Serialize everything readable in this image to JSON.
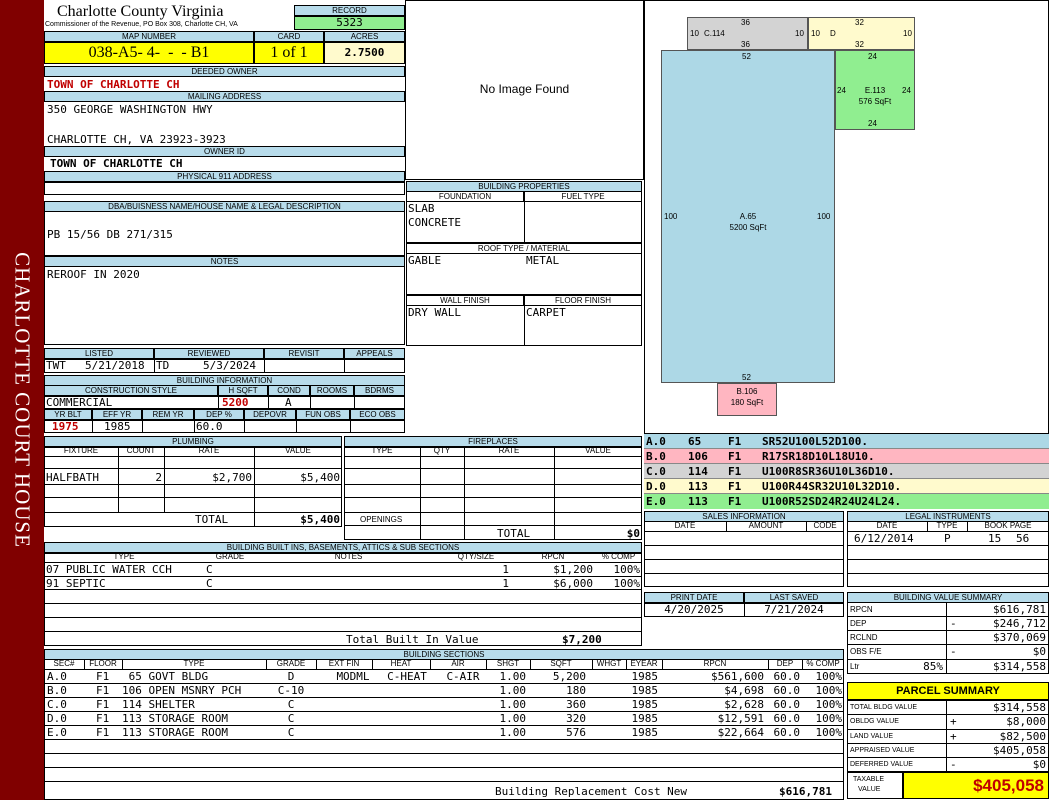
{
  "sidebar_title": "CHARLOTTE COURT HOUSE",
  "header": {
    "county": "Charlotte County Virginia",
    "commissioner": "Commissioner of the Revenue, PO Box 308, Charlotte CH, VA",
    "record_label": "RECORD",
    "record": "5323",
    "map_number_label": "MAP NUMBER",
    "map_number": "038-A5- 4-  -  - B1",
    "card_label": "CARD",
    "card": "1 of 1",
    "acres_label": "ACRES",
    "acres": "2.7500"
  },
  "owner": {
    "deeded_owner_label": "DEEDED OWNER",
    "deeded_owner": "TOWN OF CHARLOTTE CH",
    "mailing_address_label": "MAILING ADDRESS",
    "address_line1": "350 GEORGE WASHINGTON HWY",
    "address_line2": "CHARLOTTE CH, VA 23923-3923",
    "owner_id_label": "OWNER ID",
    "owner_id": "TOWN OF CHARLOTTE CH",
    "physical_address_label": "PHYSICAL 911 ADDRESS",
    "physical_address": "",
    "dba_label": "DBA/BUISNESS NAME/HOUSE NAME & LEGAL DESCRIPTION",
    "legal_description": "PB 15/56 DB 271/315",
    "notes_label": "NOTES",
    "notes": "REROOF IN 2020"
  },
  "listing": {
    "listed_label": "LISTED",
    "reviewed_label": "REVIEWED",
    "revisit_label": "REVISIT",
    "appeals_label": "APPEALS",
    "listed_by": "TWT",
    "listed_date": "5/21/2018",
    "reviewed_by": "TD",
    "reviewed_date": "5/3/2024"
  },
  "building_info": {
    "title": "BUILDING INFORMATION",
    "construction_style_label": "CONSTRUCTION STYLE",
    "hsqft_label": "H SQFT",
    "cond_label": "COND",
    "rooms_label": "ROOMS",
    "bdrms_label": "BDRMS",
    "construction_style": "COMMERCIAL",
    "hsqft": "5200",
    "cond": "A",
    "yr_blt_label": "YR BLT",
    "eff_yr_label": "EFF YR",
    "rem_yr_label": "REM YR",
    "dep_pct_label": "DEP %",
    "depovr_label": "DEPOVR",
    "fun_obs_label": "FUN OBS",
    "eco_obs_label": "ECO OBS",
    "yr_blt": "1975",
    "eff_yr": "1985",
    "dep_pct": "60.0"
  },
  "image_placeholder": "No Image Found",
  "building_properties": {
    "title": "BUILDING PROPERTIES",
    "foundation_label": "FOUNDATION",
    "fuel_type_label": "FUEL TYPE",
    "foundation": [
      "SLAB",
      "CONCRETE"
    ],
    "roof_label": "ROOF TYPE / MATERIAL",
    "roof_type": "GABLE",
    "roof_material": "METAL",
    "wall_finish_label": "WALL FINISH",
    "floor_finish_label": "FLOOR FINISH",
    "wall_finish": "DRY WALL",
    "floor_finish": "CARPET"
  },
  "sketch": {
    "sections": [
      {
        "id": "A.65",
        "area": "5200 SqFt",
        "color": "#add8e6"
      },
      {
        "id": "B.106",
        "area": "180 SqFt",
        "color": "#ffb6c1"
      },
      {
        "id": "C.114",
        "area": "",
        "color": "#d3d3d3"
      },
      {
        "id": "D",
        "area": "",
        "color": "#fffacd"
      },
      {
        "id": "E.113",
        "area": "576 SqFt",
        "color": "#90ee90"
      }
    ],
    "dims": {
      "a_top": "52",
      "a_left": "100",
      "a_right": "100",
      "a_bottom": "52",
      "c_top": "36",
      "c_left": "10",
      "c_right": "10",
      "c_bottom": "36",
      "d_top": "32",
      "d_left": "10",
      "d_right": "10",
      "d_bottom": "32",
      "e_top": "24",
      "e_left": "24",
      "e_right": "24",
      "e_bottom": "24"
    }
  },
  "sketch_legend": [
    {
      "id": "A.0",
      "code": "65",
      "floor": "F1",
      "vectors": "SR52U100L52D100.",
      "color": "#add8e6"
    },
    {
      "id": "B.0",
      "code": "106",
      "floor": "F1",
      "vectors": "R17SR18D10L18U10.",
      "color": "#ffb6c1"
    },
    {
      "id": "C.0",
      "code": "114",
      "floor": "F1",
      "vectors": "U100R8SR36U10L36D10.",
      "color": "#d3d3d3"
    },
    {
      "id": "D.0",
      "code": "113",
      "floor": "F1",
      "vectors": "U100R44SR32U10L32D10.",
      "color": "#fffacd"
    },
    {
      "id": "E.0",
      "code": "113",
      "floor": "F1",
      "vectors": "U100R52SD24R24U24L24.",
      "color": "#90ee90"
    }
  ],
  "plumbing": {
    "title": "PLUMBING",
    "headers": [
      "FIXTURE",
      "COUNT",
      "RATE",
      "VALUE"
    ],
    "rows": [
      {
        "fixture": "HALFBATH",
        "count": "2",
        "rate": "$2,700",
        "value": "$5,400"
      }
    ],
    "total_label": "TOTAL",
    "total": "$5,400"
  },
  "fireplaces": {
    "title": "FIREPLACES",
    "headers": [
      "TYPE",
      "QTY",
      "RATE",
      "VALUE"
    ],
    "openings_label": "OPENINGS",
    "total_label": "TOTAL",
    "total": "$0"
  },
  "built_ins": {
    "title": "BUILDING BUILT INS, BASEMENTS, ATTICS & SUB SECTIONS",
    "headers": [
      "TYPE",
      "GRADE",
      "NOTES",
      "QTY/SIZE",
      "RPCN",
      "% COMP"
    ],
    "rows": [
      {
        "type": "07 PUBLIC WATER CCH",
        "grade": "C",
        "qty": "1",
        "rpcn": "$1,200",
        "comp": "100%"
      },
      {
        "type": "91 SEPTIC",
        "grade": "C",
        "qty": "1",
        "rpcn": "$6,000",
        "comp": "100%"
      }
    ],
    "total_label": "Total Built In Value",
    "total": "$7,200"
  },
  "sales": {
    "title": "SALES INFORMATION",
    "headers": [
      "DATE",
      "AMOUNT",
      "CODE"
    ]
  },
  "legal": {
    "title": "LEGAL INSTRUMENTS",
    "headers": [
      "DATE",
      "TYPE",
      "BOOK PAGE"
    ],
    "rows": [
      {
        "date": "6/12/2014",
        "type": "P",
        "book": "15",
        "page": "56"
      }
    ]
  },
  "dates": {
    "print_label": "PRINT DATE",
    "print_date": "4/20/2025",
    "saved_label": "LAST SAVED",
    "saved_date": "7/21/2024"
  },
  "value_summary": {
    "title": "BUILDING VALUE SUMMARY",
    "rows": [
      {
        "label": "RPCN",
        "sign": "",
        "pct": "",
        "value": "$616,781"
      },
      {
        "label": "DEP",
        "sign": "-",
        "pct": "",
        "value": "$246,712"
      },
      {
        "label": "RCLND",
        "sign": "",
        "pct": "",
        "value": "$370,069"
      },
      {
        "label": "OBS F/E",
        "sign": "-",
        "pct": "",
        "value": "$0"
      },
      {
        "label": "Ltr",
        "sign": "",
        "pct": "85%",
        "value": "$314,558"
      }
    ]
  },
  "parcel_summary": {
    "title": "PARCEL SUMMARY",
    "rows": [
      {
        "label": "TOTAL BLDG VALUE",
        "sign": "",
        "value": "$314,558"
      },
      {
        "label": "OBLDG VALUE",
        "sign": "+",
        "value": "$8,000"
      },
      {
        "label": "LAND VALUE",
        "sign": "+",
        "value": "$82,500"
      },
      {
        "label": "APPRAISED VALUE",
        "sign": "",
        "value": "$405,058"
      },
      {
        "label": "DEFERRED VALUE",
        "sign": "-",
        "value": "$0"
      }
    ],
    "taxable_label_1": "TAXABLE",
    "taxable_label_2": "VALUE",
    "taxable_value": "$405,058"
  },
  "sections": {
    "title": "BUILDING SECTIONS",
    "headers": [
      "SEC#",
      "FLOOR",
      "TYPE",
      "GRADE",
      "EXT FIN",
      "HEAT",
      "AIR",
      "SHGT",
      "SQFT",
      "WHGT",
      "EYEAR",
      "RPCN",
      "DEP",
      "% COMP"
    ],
    "rows": [
      {
        "sec": "A.0",
        "floor": "F1",
        "type": " 65 GOVT BLDG",
        "grade": "D",
        "ext": "MODML",
        "heat": "C-HEAT",
        "air": "C-AIR",
        "shgt": "1.00",
        "sqft": "5,200",
        "eyear": "1985",
        "rpcn": "$561,600",
        "dep": "60.0",
        "comp": "100%"
      },
      {
        "sec": "B.0",
        "floor": "F1",
        "type": "106 OPEN MSNRY PCH",
        "grade": "C-10",
        "ext": "",
        "heat": "",
        "air": "",
        "shgt": "1.00",
        "sqft": "180",
        "eyear": "1985",
        "rpcn": "$4,698",
        "dep": "60.0",
        "comp": "100%"
      },
      {
        "sec": "C.0",
        "floor": "F1",
        "type": "114 SHELTER",
        "grade": "C",
        "ext": "",
        "heat": "",
        "air": "",
        "shgt": "1.00",
        "sqft": "360",
        "eyear": "1985",
        "rpcn": "$2,628",
        "dep": "60.0",
        "comp": "100%"
      },
      {
        "sec": "D.0",
        "floor": "F1",
        "type": "113 STORAGE ROOM",
        "grade": "C",
        "ext": "",
        "heat": "",
        "air": "",
        "shgt": "1.00",
        "sqft": "320",
        "eyear": "1985",
        "rpcn": "$12,591",
        "dep": "60.0",
        "comp": "100%"
      },
      {
        "sec": "E.0",
        "floor": "F1",
        "type": "113 STORAGE ROOM",
        "grade": "C",
        "ext": "",
        "heat": "",
        "air": "",
        "shgt": "1.00",
        "sqft": "576",
        "eyear": "1985",
        "rpcn": "$22,664",
        "dep": "60.0",
        "comp": "100%"
      }
    ],
    "total_label": "Building Replacement Cost New",
    "total": "$616,781"
  }
}
